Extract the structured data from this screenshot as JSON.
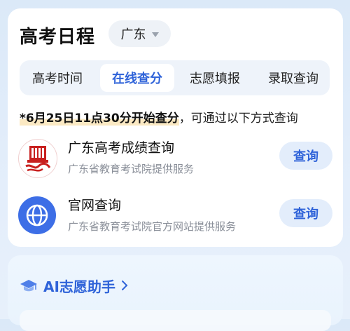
{
  "schedule": {
    "title": "高考日程",
    "region": "广东",
    "tabs": [
      {
        "label": "高考时间",
        "active": false
      },
      {
        "label": "在线查分",
        "active": true
      },
      {
        "label": "志愿填报",
        "active": false
      },
      {
        "label": "录取查询",
        "active": false
      }
    ],
    "notice_highlight": "*6月25日11点30分开始查分",
    "notice_rest": "，可通过以下方式查询",
    "services": [
      {
        "icon": "exam-institute-logo-icon",
        "name": "广东高考成绩查询",
        "subtitle": "广东省教育考试院提供服务",
        "button": "查询"
      },
      {
        "icon": "globe-icon",
        "name": "官网查询",
        "subtitle": "广东省教育考试院官方网站提供服务",
        "button": "查询"
      }
    ]
  },
  "assistant": {
    "icon": "graduation-cap-icon",
    "title": "AI志愿助手"
  },
  "colors": {
    "accent": "#2f63d9",
    "button_bg": "#e3edfb",
    "highlight": "#fbe9c3",
    "logo_red": "#c8201f"
  }
}
